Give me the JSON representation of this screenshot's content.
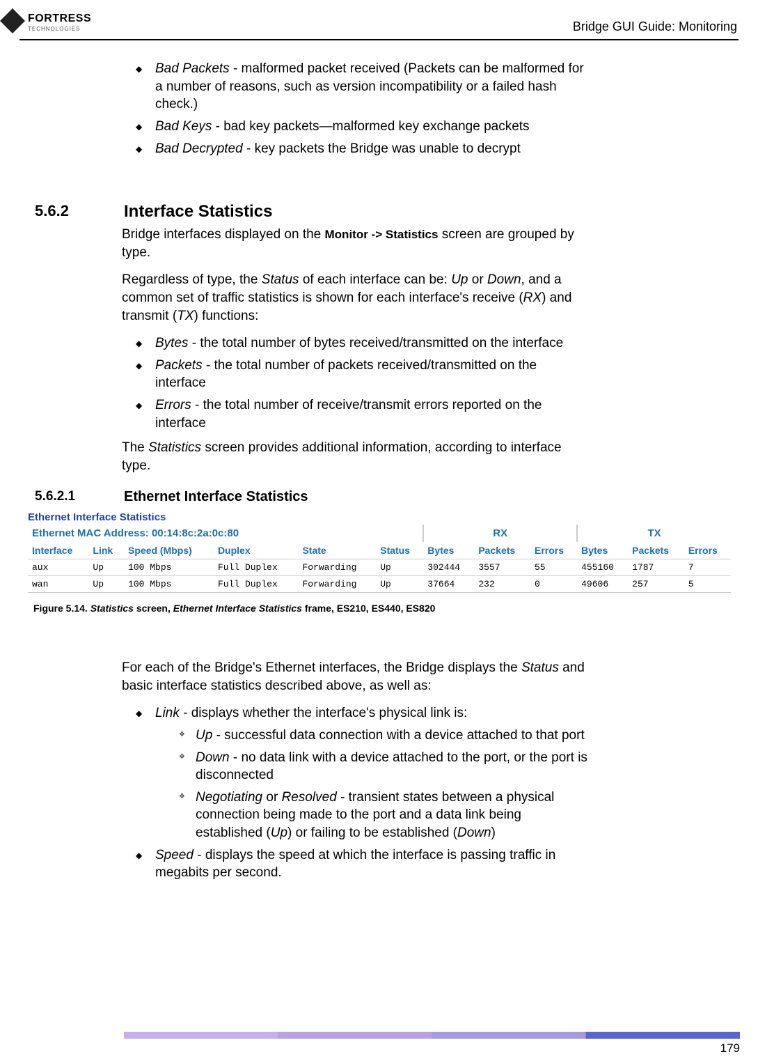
{
  "logo": {
    "name": "FORTRESS",
    "sub": "TECHNOLOGIES"
  },
  "header": {
    "right": "Bridge GUI Guide: Monitoring"
  },
  "top_bullets": {
    "bad_packets_term": "Bad Packets",
    "bad_packets_desc": " - malformed packet received (Packets can be malformed for a number of reasons, such as version incompatibility or a failed hash check.)",
    "bad_keys_term": "Bad Keys",
    "bad_keys_desc": " - bad key packets—malformed key exchange packets",
    "bad_decrypted_term": "Bad Decrypted",
    "bad_decrypted_desc": " - key packets the Bridge was unable to decrypt"
  },
  "section_562": {
    "num": "5.6.2",
    "title": "Interface Statistics",
    "p1a": "Bridge interfaces displayed on the ",
    "p1b": "Monitor -> Statistics",
    "p1c": " screen are grouped by type.",
    "p2a": "Regardless of type, the ",
    "p2b": "Status",
    "p2c": " of each interface can be: ",
    "p2d": "Up",
    "p2e": " or ",
    "p2f": "Down",
    "p2g": ", and a common set of traffic statistics is shown for each interface's receive (",
    "p2h": "RX",
    "p2i": ") and transmit (",
    "p2j": "TX",
    "p2k": ") functions:",
    "b1_term": "Bytes",
    "b1_desc": " - the total number of bytes received/transmitted on the interface",
    "b2_term": "Packets",
    "b2_desc": " - the total number of packets received/transmitted on the interface",
    "b3_term": "Errors",
    "b3_desc": " - the total number of receive/transmit errors reported on the interface",
    "p3a": "The ",
    "p3b": "Statistics",
    "p3c": " screen provides additional information, according to interface type."
  },
  "section_5621": {
    "num": "5.6.2.1",
    "title": "Ethernet Interface Statistics"
  },
  "table": {
    "frame_title": "Ethernet Interface Statistics",
    "mac_label": "Ethernet MAC Address: 00:14:8c:2a:0c:80",
    "rx": "RX",
    "tx": "TX",
    "cols": {
      "iface": "Interface",
      "link": "Link",
      "speed": "Speed (Mbps)",
      "duplex": "Duplex",
      "state": "State",
      "status": "Status",
      "bytes": "Bytes",
      "packets": "Packets",
      "errors": "Errors",
      "bytes2": "Bytes",
      "packets2": "Packets",
      "errors2": "Errors"
    },
    "rows": [
      {
        "iface": "aux",
        "link": "Up",
        "speed": "100 Mbps",
        "duplex": "Full Duplex",
        "state": "Forwarding",
        "status": "Up",
        "rx_bytes": "302444",
        "rx_packets": "3557",
        "rx_errors": "55",
        "tx_bytes": "455160",
        "tx_packets": "1787",
        "tx_errors": "7"
      },
      {
        "iface": "wan",
        "link": "Up",
        "speed": "100 Mbps",
        "duplex": "Full Duplex",
        "state": "Forwarding",
        "status": "Up",
        "rx_bytes": "37664",
        "rx_packets": "232",
        "rx_errors": "0",
        "tx_bytes": "49606",
        "tx_packets": "257",
        "tx_errors": "5"
      }
    ]
  },
  "figure_caption": {
    "prefix": "Figure 5.14. ",
    "i1": "Statistics",
    "mid1": " screen, ",
    "i2": "Ethernet Interface Statistics",
    "suffix": " frame, ES210, ES440, ES820"
  },
  "post_table": {
    "p1a": "For each of the Bridge's Ethernet interfaces, the Bridge displays the ",
    "p1b": "Status",
    "p1c": " and basic interface statistics described above, as well as:",
    "link_term": "Link",
    "link_desc": " - displays whether the interface's physical link is:",
    "up_term": "Up",
    "up_desc": " - successful data connection with a device attached to that port",
    "down_term": "Down",
    "down_desc": " - no data link with a device attached to the port, or the port is disconnected",
    "neg_term": "Negotiating",
    "neg_or": " or ",
    "res_term": "Resolved",
    "neg_desc_a": " - transient states between a physical connection being made to the port and a data link being established (",
    "neg_desc_up": "Up",
    "neg_desc_b": ") or failing to be established (",
    "neg_desc_down": "Down",
    "neg_desc_c": ")",
    "speed_term": "Speed",
    "speed_desc": " - displays the speed at which the interface is passing traffic in megabits per second."
  },
  "page_number": "179"
}
